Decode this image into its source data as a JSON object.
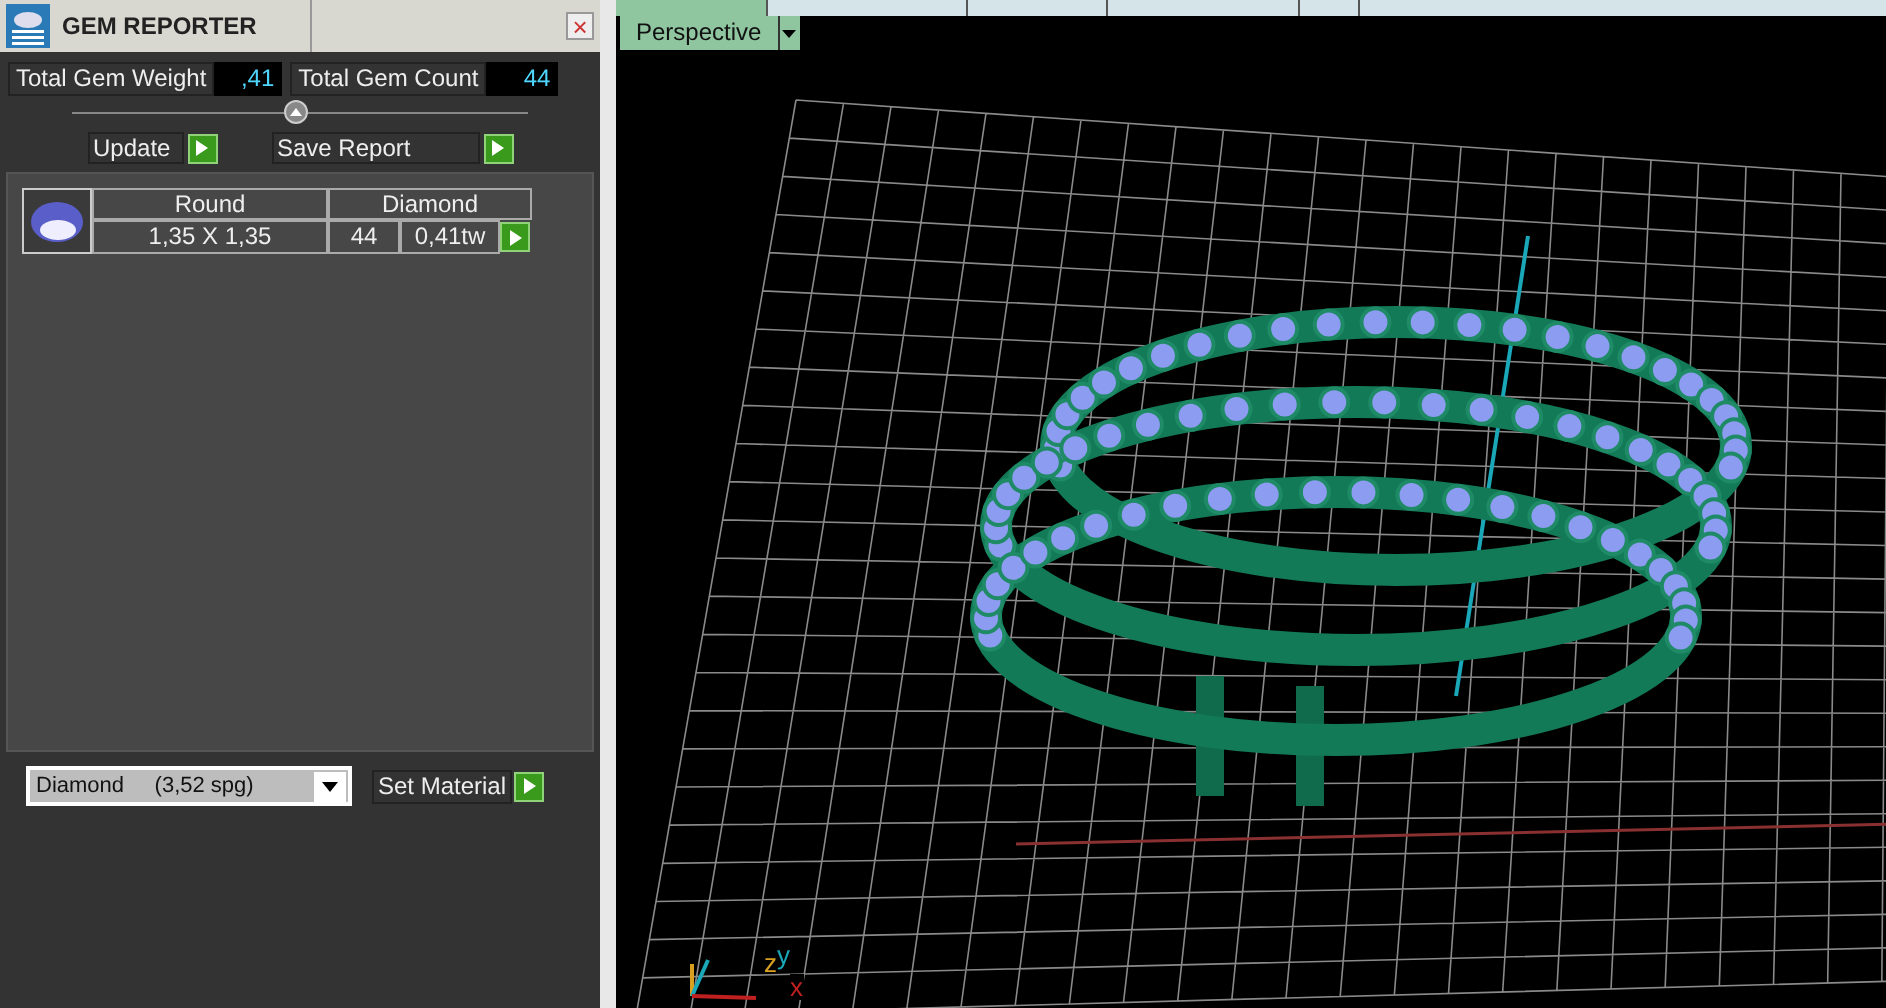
{
  "panel": {
    "title": "GEM REPORTER",
    "close": "×"
  },
  "totals": [
    {
      "label": "Total Gem Weight",
      "value": ",41"
    },
    {
      "label": "Total Gem Count",
      "value": "44"
    }
  ],
  "actions": [
    {
      "label": "Update"
    },
    {
      "label": "Save Report"
    }
  ],
  "gems": [
    {
      "shape": "Round",
      "material": "Diamond",
      "size": "1,35 X 1,35",
      "count": "44",
      "weight": "0,41tw"
    }
  ],
  "material_select": {
    "value": "Diamond     (3,52 spg)"
  },
  "set_material": {
    "label": "Set Material"
  },
  "viewport": {
    "tabs": [
      {
        "selected": true
      },
      {
        "selected": false
      },
      {
        "selected": false
      },
      {
        "selected": false
      },
      {
        "selected": false
      }
    ],
    "view": "Perspective",
    "axes": [
      "z",
      "y",
      "x"
    ]
  }
}
